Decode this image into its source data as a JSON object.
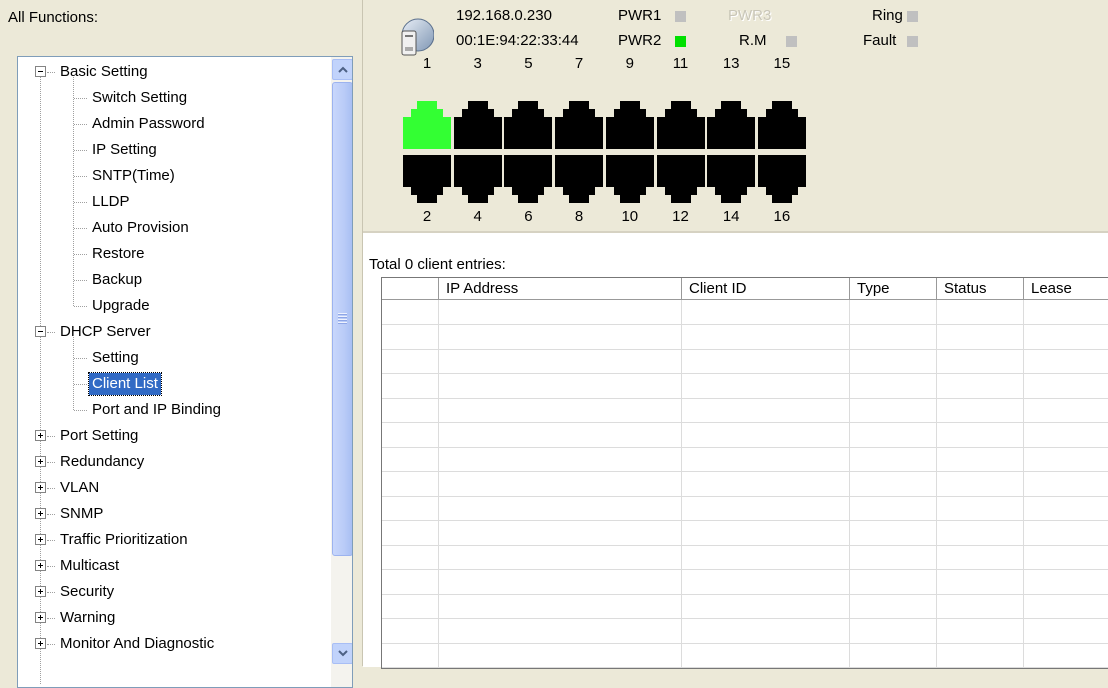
{
  "left": {
    "title": "All Functions:",
    "tree": [
      {
        "label": "Basic Setting",
        "type": "parent",
        "expanded": true
      },
      {
        "label": "Switch Setting",
        "type": "child"
      },
      {
        "label": "Admin Password",
        "type": "child"
      },
      {
        "label": "IP Setting",
        "type": "child"
      },
      {
        "label": "SNTP(Time)",
        "type": "child"
      },
      {
        "label": "LLDP",
        "type": "child"
      },
      {
        "label": "Auto Provision",
        "type": "child"
      },
      {
        "label": "Restore",
        "type": "child"
      },
      {
        "label": "Backup",
        "type": "child"
      },
      {
        "label": "Upgrade",
        "type": "child"
      },
      {
        "label": "DHCP Server",
        "type": "parent",
        "expanded": true
      },
      {
        "label": "Setting",
        "type": "child"
      },
      {
        "label": "Client List",
        "type": "child",
        "selected": true
      },
      {
        "label": "Port and IP Binding",
        "type": "child"
      },
      {
        "label": "Port Setting",
        "type": "parent",
        "expanded": false
      },
      {
        "label": "Redundancy",
        "type": "parent",
        "expanded": false
      },
      {
        "label": "VLAN",
        "type": "parent",
        "expanded": false
      },
      {
        "label": "SNMP",
        "type": "parent",
        "expanded": false
      },
      {
        "label": "Traffic Prioritization",
        "type": "parent",
        "expanded": false
      },
      {
        "label": "Multicast",
        "type": "parent",
        "expanded": false
      },
      {
        "label": "Security",
        "type": "parent",
        "expanded": false
      },
      {
        "label": "Warning",
        "type": "parent",
        "expanded": false
      },
      {
        "label": "Monitor And Diagnostic",
        "type": "parent",
        "expanded": false
      }
    ]
  },
  "device": {
    "ip": "192.168.0.230",
    "mac": "00:1E:94:22:33:44",
    "indicators": {
      "pwr1": {
        "label": "PWR1",
        "color": "#c0c0c0"
      },
      "pwr2": {
        "label": "PWR2",
        "color": "#00e000"
      },
      "pwr3": {
        "label": "PWR3",
        "color": "#d4d0c8",
        "dimmed": true
      },
      "rm": {
        "label": "R.M",
        "color": "#c0c0c0"
      },
      "ring": {
        "label": "Ring",
        "color": "#c0c0c0"
      },
      "fault": {
        "label": "Fault",
        "color": "#c0c0c0"
      }
    },
    "top_ports": [
      "1",
      "3",
      "5",
      "7",
      "9",
      "11",
      "13",
      "15"
    ],
    "bottom_ports": [
      "2",
      "4",
      "6",
      "8",
      "10",
      "12",
      "14",
      "16"
    ],
    "active_ports": [
      "1"
    ],
    "port_active_color": "#33ff33",
    "port_inactive_color": "#000000"
  },
  "client_list": {
    "summary": "Total 0 client entries:",
    "columns": [
      "",
      "IP Address",
      "Client ID",
      "Type",
      "Status",
      "Lease"
    ]
  }
}
